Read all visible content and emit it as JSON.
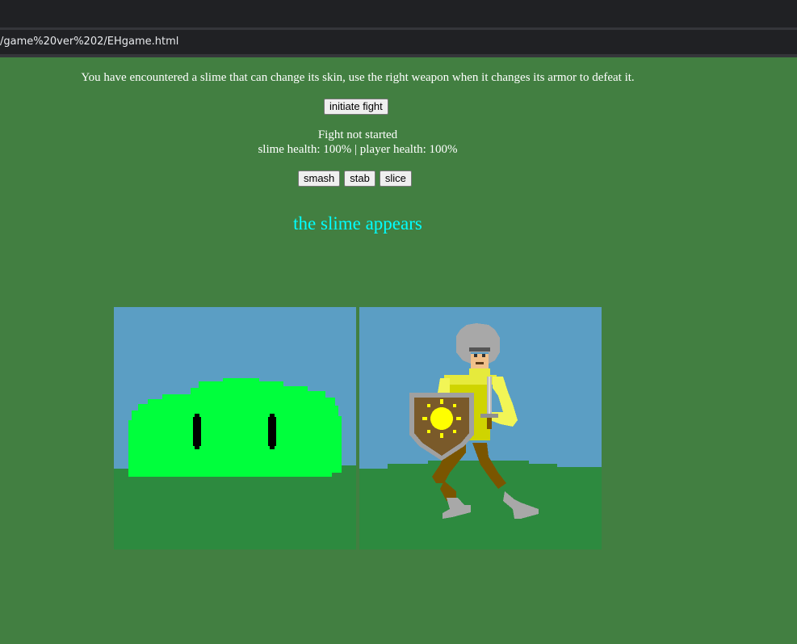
{
  "browser": {
    "url": "/game%20ver%202/EHgame.html"
  },
  "intro_text": "You have encountered a slime that can change its skin, use the right weapon when it changes its armor to defeat it.",
  "buttons": {
    "initiate": "initiate fight",
    "smash": "smash",
    "stab": "stab",
    "slice": "slice"
  },
  "status": {
    "fight_state": "Fight not started",
    "health_line": "slime health: 100% | player health: 100%",
    "slime_health_pct": 100,
    "player_health_pct": 100
  },
  "message": "the slime appears",
  "colors": {
    "page_background": "#427f41",
    "sky": "#5b9ec4",
    "grass": "#2d8a3f",
    "slime": "#00ff3c",
    "message_text": "#00ffff"
  }
}
